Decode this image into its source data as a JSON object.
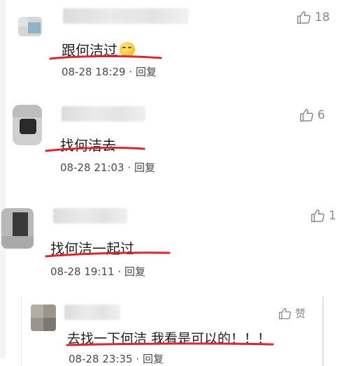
{
  "comments": [
    {
      "text": "跟何洁过",
      "emoji": "thinking-face-icon",
      "time": "08-28 18:29",
      "reply": "回复",
      "likes": "18"
    },
    {
      "text": "找何洁去",
      "time": "08-28 21:03",
      "reply": "回复",
      "likes": "6"
    },
    {
      "text": "找何洁一起过",
      "time": "08-28 19:11",
      "reply": "回复",
      "likes": "1"
    }
  ],
  "reply_comment": {
    "text": "去找一下何洁 我看是可以的！！！",
    "time": "08-28 23:35",
    "reply": "回复",
    "likes": "赞"
  },
  "separator": "·",
  "colors": {
    "underline": "#d8282e",
    "text": "#1f1f1f",
    "meta": "#4a4a4a",
    "like": "#8a8a8a"
  }
}
